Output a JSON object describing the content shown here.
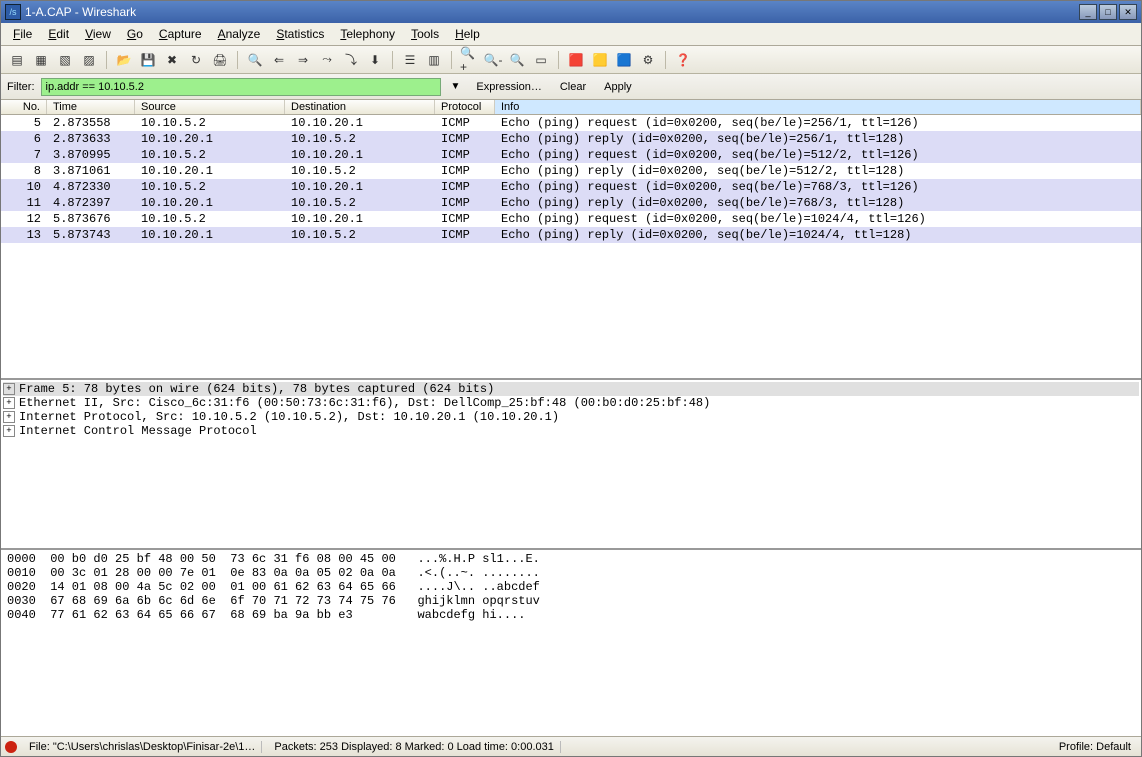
{
  "title": "1-A.CAP - Wireshark",
  "menus": [
    "File",
    "Edit",
    "View",
    "Go",
    "Capture",
    "Analyze",
    "Statistics",
    "Telephony",
    "Tools",
    "Help"
  ],
  "toolbar_icons": [
    "list",
    "card",
    "card2",
    "card3",
    "",
    "open",
    "save",
    "close",
    "reload",
    "print",
    "",
    "find",
    "back",
    "fwd",
    "jump",
    "last",
    "down",
    "",
    "view1",
    "view2",
    "",
    "zoomin",
    "zoomout",
    "zoom1",
    "fit",
    "",
    "color1",
    "color2",
    "color3",
    "prefs",
    "",
    "help"
  ],
  "filter": {
    "label": "Filter:",
    "value": "ip.addr == 10.10.5.2",
    "expression": "Expression…",
    "clear": "Clear",
    "apply": "Apply"
  },
  "columns": {
    "no": "No.",
    "time": "Time",
    "src": "Source",
    "dst": "Destination",
    "proto": "Protocol",
    "info": "Info"
  },
  "packets": [
    {
      "no": "5",
      "time": "2.873558",
      "src": "10.10.5.2",
      "dst": "10.10.20.1",
      "proto": "ICMP",
      "info": "Echo (ping) request  (id=0x0200, seq(be/le)=256/1, ttl=126)",
      "sel": false
    },
    {
      "no": "6",
      "time": "2.873633",
      "src": "10.10.20.1",
      "dst": "10.10.5.2",
      "proto": "ICMP",
      "info": "Echo (ping) reply    (id=0x0200, seq(be/le)=256/1, ttl=128)",
      "sel": true
    },
    {
      "no": "7",
      "time": "3.870995",
      "src": "10.10.5.2",
      "dst": "10.10.20.1",
      "proto": "ICMP",
      "info": "Echo (ping) request  (id=0x0200, seq(be/le)=512/2, ttl=126)",
      "sel": true
    },
    {
      "no": "8",
      "time": "3.871061",
      "src": "10.10.20.1",
      "dst": "10.10.5.2",
      "proto": "ICMP",
      "info": "Echo (ping) reply    (id=0x0200, seq(be/le)=512/2, ttl=128)",
      "sel": false
    },
    {
      "no": "10",
      "time": "4.872330",
      "src": "10.10.5.2",
      "dst": "10.10.20.1",
      "proto": "ICMP",
      "info": "Echo (ping) request  (id=0x0200, seq(be/le)=768/3, ttl=126)",
      "sel": true
    },
    {
      "no": "11",
      "time": "4.872397",
      "src": "10.10.20.1",
      "dst": "10.10.5.2",
      "proto": "ICMP",
      "info": "Echo (ping) reply    (id=0x0200, seq(be/le)=768/3, ttl=128)",
      "sel": true
    },
    {
      "no": "12",
      "time": "5.873676",
      "src": "10.10.5.2",
      "dst": "10.10.20.1",
      "proto": "ICMP",
      "info": "Echo (ping) request  (id=0x0200, seq(be/le)=1024/4, ttl=126)",
      "sel": false
    },
    {
      "no": "13",
      "time": "5.873743",
      "src": "10.10.20.1",
      "dst": "10.10.5.2",
      "proto": "ICMP",
      "info": "Echo (ping) reply    (id=0x0200, seq(be/le)=1024/4, ttl=128)",
      "sel": true
    }
  ],
  "details": [
    "Frame 5: 78 bytes on wire (624 bits), 78 bytes captured (624 bits)",
    "Ethernet II, Src: Cisco_6c:31:f6 (00:50:73:6c:31:f6), Dst: DellComp_25:bf:48 (00:b0:d0:25:bf:48)",
    "Internet Protocol, Src: 10.10.5.2 (10.10.5.2), Dst: 10.10.20.1 (10.10.20.1)",
    "Internet Control Message Protocol"
  ],
  "hex": "0000  00 b0 d0 25 bf 48 00 50  73 6c 31 f6 08 00 45 00   ...%.H.P sl1...E.\n0010  00 3c 01 28 00 00 7e 01  0e 83 0a 0a 05 02 0a 0a   .<.(..~. ........\n0020  14 01 08 00 4a 5c 02 00  01 00 61 62 63 64 65 66   ....J\\.. ..abcdef\n0030  67 68 69 6a 6b 6c 6d 6e  6f 70 71 72 73 74 75 76   ghijklmn opqrstuv\n0040  77 61 62 63 64 65 66 67  68 69 ba 9a bb e3         wabcdefg hi....",
  "status": {
    "file": "File: \"C:\\Users\\chrislas\\Desktop\\Finisar-2e\\1…",
    "packets": "Packets: 253 Displayed: 8 Marked: 0 Load time: 0:00.031",
    "profile": "Profile: Default"
  }
}
